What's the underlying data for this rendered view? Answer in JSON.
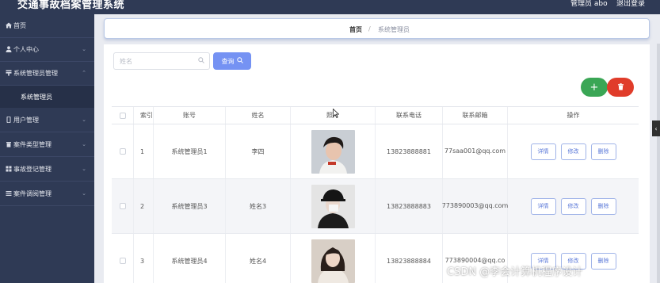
{
  "header": {
    "title": "交通事故档案管理系统",
    "user": "管理员 abo",
    "logout": "退出登录"
  },
  "sidebar": {
    "items": [
      {
        "label": "首页",
        "icon": "home-icon"
      },
      {
        "label": "个人中心",
        "icon": "user-icon"
      },
      {
        "label": "系统管理员管理",
        "icon": "admin-icon"
      },
      {
        "label": "系统管理员",
        "sub": true
      },
      {
        "label": "用户管理",
        "icon": "phone-icon"
      },
      {
        "label": "案件类型管理",
        "icon": "trash-icon"
      },
      {
        "label": "事故登记管理",
        "icon": "grid-icon"
      },
      {
        "label": "案件调阅管理",
        "icon": "list-icon"
      }
    ]
  },
  "breadcrumb": {
    "home": "首页",
    "separator": "/",
    "current": "系统管理员"
  },
  "search": {
    "placeholder": "姓名",
    "button_label": "查询"
  },
  "actions": {
    "add_label": "+"
  },
  "table": {
    "headers": [
      "索引",
      "账号",
      "姓名",
      "照片",
      "联系电话",
      "联系邮箱",
      "操作"
    ],
    "rows": [
      {
        "index": "1",
        "account": "系统管理员1",
        "name": "李四",
        "phone": "13823888881",
        "email": "77saa001@qq.com",
        "photo": "male-portrait"
      },
      {
        "index": "2",
        "account": "系统管理员3",
        "name": "姓名3",
        "phone": "13823888883",
        "email": "773890003@qq.com",
        "photo": "female-portrait-hat"
      },
      {
        "index": "3",
        "account": "系统管理员4",
        "name": "姓名4",
        "phone": "13823888884",
        "email": "773890004@qq.co",
        "photo": "female-portrait"
      }
    ],
    "row_buttons": {
      "detail": "详情",
      "edit": "修改",
      "delete": "删除"
    }
  },
  "watermark": "CSDN @李会计算机程序设计",
  "colors": {
    "sidebar_bg": "#2f3a55",
    "primary": "#7592f3",
    "success": "#3aa655",
    "danger": "#e03c2a"
  }
}
